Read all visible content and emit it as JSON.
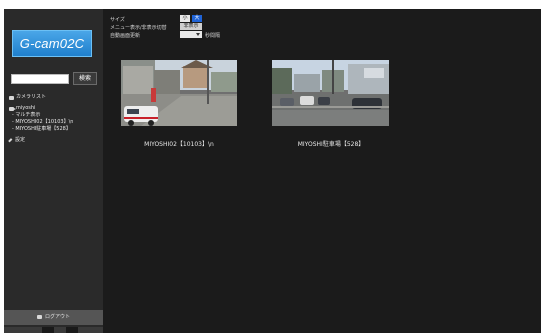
{
  "sidebar": {
    "logo_text": "G-cam02C",
    "search": {
      "value": "",
      "placeholder": "",
      "button_label": "検索"
    },
    "nav": {
      "camera_list_label": "カメラリスト",
      "group_label": "miyoshi",
      "multi_view_label": "- マルチ表示",
      "cameras": [
        "- MIYOSHI02【10103】\\n",
        "- MIYOSHI駐車場【528】"
      ],
      "settings_label": "設定"
    },
    "logout_label": "ログアウト"
  },
  "settings": {
    "size_label": "サイズ",
    "size_small": "小",
    "size_large": "大",
    "menu_label": "メニュー表示/非表示切替",
    "menu_toggle": "非表示",
    "refresh_label": "自動画面更新",
    "refresh_value": "",
    "refresh_suffix": "秒間隔"
  },
  "cameras": [
    {
      "label": "MIYOSHI02【10103】\\n"
    },
    {
      "label": "MIYOSHI駐車場【528】"
    }
  ],
  "colors": {
    "background": "#1b1b1b",
    "sidebar": "#2a2a2a",
    "logo_blue": "#2b8fdb",
    "accent_blue": "#1f63d6"
  }
}
